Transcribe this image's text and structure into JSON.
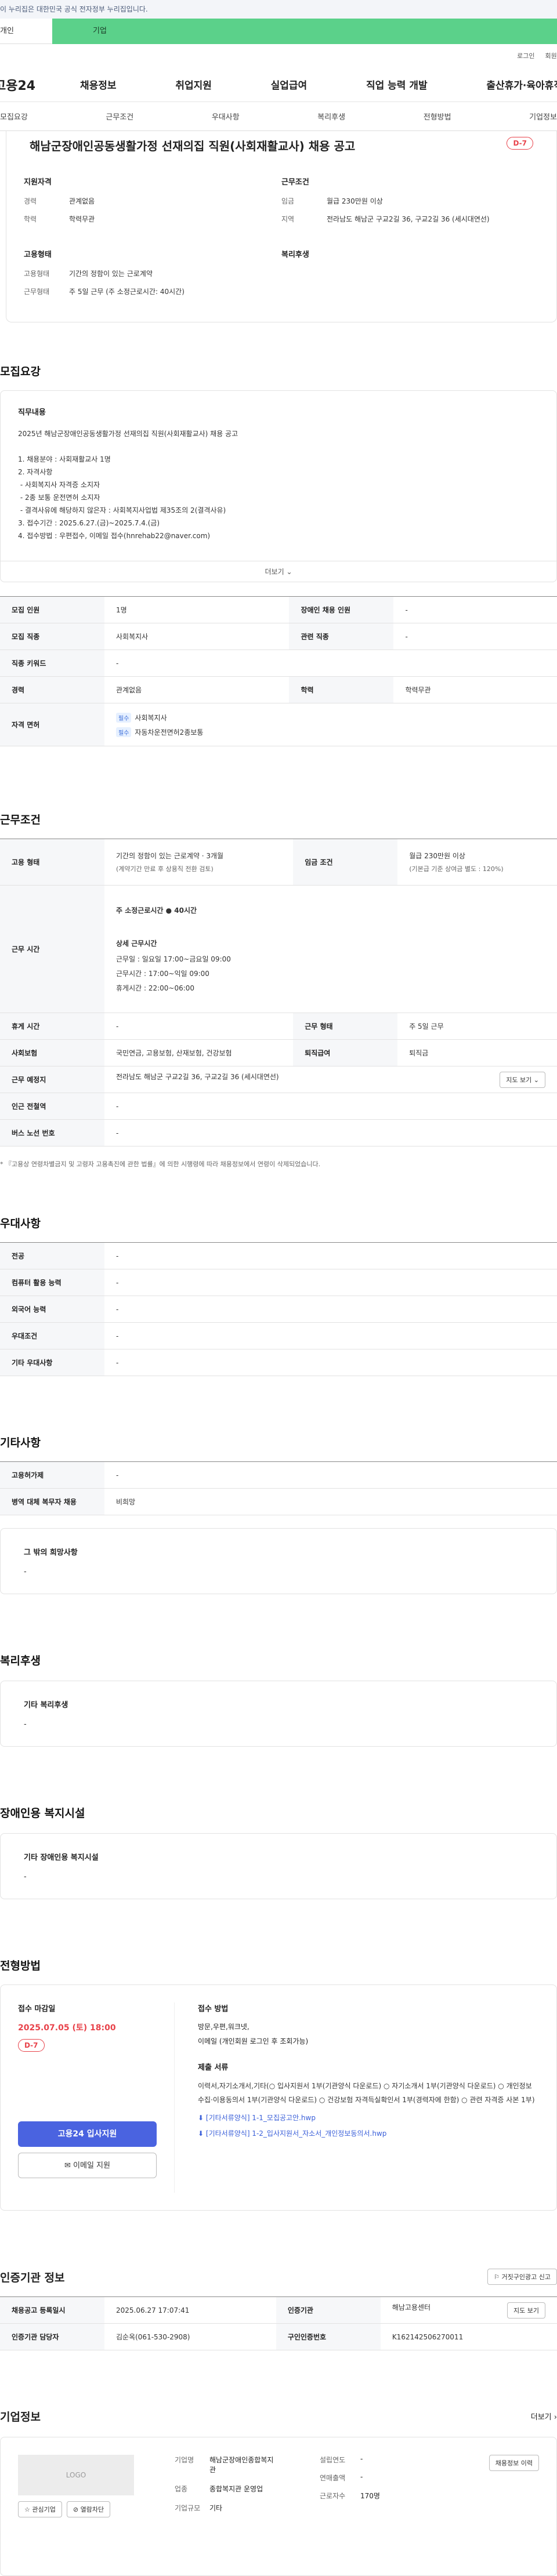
{
  "gov_notice": "이 누리집은 대한민국 공식 전자정부 누리집입니다.",
  "tabs": {
    "personal": "개인",
    "company": "기업"
  },
  "top_links": [
    "로그인",
    "회원가입"
  ],
  "logo": "고용24",
  "gnb": [
    "채용정보",
    "취업지원",
    "실업급여",
    "직업 능력 개발",
    "출산휴가·육아휴직"
  ],
  "anchors": [
    "모집요강",
    "근무조건",
    "우대사항",
    "복리후생",
    "전형방법",
    "기업정보"
  ],
  "summary": {
    "title": "해남군장애인공동생활가정 선재의집 직원(사회재활교사) 채용 공고",
    "dday": "D-7",
    "qual_head": "지원자격",
    "career_k": "경력",
    "career_v": "관계없음",
    "edu_k": "학력",
    "edu_v": "학력무관",
    "emp_head": "고용형태",
    "emp_k": "고용형태",
    "emp_v": "기간의 정함이 있는 근로계약",
    "worktype_k": "근무형태",
    "worktype_v": "주 5일 근무 (주 소정근로시간: 40시간)",
    "cond_head": "근무조건",
    "wage_k": "임금",
    "wage_v": "월급 230만원 이상",
    "area_k": "지역",
    "area_v": "전라남도 해남군 구교2길 36, 구교2길 36 (세시대연선)",
    "welfare_head": "복리후생"
  },
  "sections": {
    "recruit": "모집요강",
    "cond": "근무조건",
    "pref": "우대사항",
    "etc": "기타사항",
    "welfare": "복리후생",
    "disabled": "장애인용 복지시설",
    "process": "전형방법",
    "cert": "인증기관 정보",
    "company": "기업정보"
  },
  "job_desc": {
    "head": "직무내용",
    "text": "2025년 해남군장애인공동생활가정 선재의집 직원(사회재활교사) 채용 공고\n\n1. 채용분야 : 사회재활교사 1명\n2. 자격사항\n - 사회복지사 자격증 소지자\n - 2종 보통 운전면허 소지자\n - 결격사유에 해당하지 않은자 : 사회복지사업법 제35조의 2(결격사유)\n3. 접수기간 : 2025.6.27.(금)~2025.7.4.(금)\n4. 접수방법 : 우편접수, 이메일 접수(hnrehab22@naver.com)",
    "more": "더보기"
  },
  "recruit_table": {
    "count_k": "모집 인원",
    "count_v": "1명",
    "dis_k": "장애인 채용 인원",
    "dis_v": "-",
    "job_k": "모집 직종",
    "job_v": "사회복지사",
    "rel_k": "관련 직종",
    "rel_v": "-",
    "kw_k": "직종 키워드",
    "kw_v": "-",
    "career_k": "경력",
    "career_v": "관계없음",
    "edu_k": "학력",
    "edu_v": "학력무관",
    "lic_k": "자격 면허",
    "lic_badge": "필수",
    "lic1": "사회복지사",
    "lic2": "자동차운전면허2종보통"
  },
  "cond_table": {
    "emp_k": "고용 형태",
    "emp_v": "기간의 정함이 있는 근로계약 · 3개월",
    "emp_v2": "(계약기간 만료 후 상용직 전환 검토)",
    "wage_k": "임금 조건",
    "wage_v": "월급 230만원 이상",
    "wage_v2": "(기본급 기준 상여금 별도 : 120%)",
    "time_k": "근무 시간",
    "time_weekly": "주 소정근로시간 ● 40시간",
    "time_detail_head": "상세 근무시간",
    "time_l1": "근무일 : 일요일 17:00~금요일 09:00",
    "time_l2": "근무시간 : 17:00~익일 09:00",
    "time_l3": "휴게시간 : 22:00~06:00",
    "rest_k": "휴게 시간",
    "rest_v": "-",
    "form_k": "근무 형태",
    "form_v": "주 5일 근무",
    "ins_k": "사회보험",
    "ins_v": "국민연금, 고용보험, 산재보험, 건강보험",
    "sev_k": "퇴직급여",
    "sev_v": "퇴직금",
    "place_k": "근무 예정지",
    "place_v": "전라남도 해남군 구교2길 36, 구교2길 36 (세시대연선)",
    "map_btn": "지도 보기",
    "station_k": "인근 전철역",
    "station_v": "-",
    "bus_k": "버스 노선 번호",
    "bus_v": "-",
    "note": "* 『고용상 연령차별금지 및 고령자 고용촉진에 관한 법률』에 의한 시행령에 따라 채용정보에서 연령이 삭제되었습니다."
  },
  "pref_table": [
    {
      "k": "전공",
      "v": "-"
    },
    {
      "k": "컴퓨터 활용 능력",
      "v": "-"
    },
    {
      "k": "외국어 능력",
      "v": "-"
    },
    {
      "k": "우대조건",
      "v": "-"
    },
    {
      "k": "기타 우대사항",
      "v": "-"
    }
  ],
  "etc_table": [
    {
      "k": "고용허가제",
      "v": "-"
    },
    {
      "k": "병역 대체 복무자 채용",
      "v": "비희망"
    }
  ],
  "etc_box": {
    "head": "그 밖의 희망사항",
    "value": "-"
  },
  "welfare_box": {
    "head": "기타 복리후생",
    "value": "-"
  },
  "disabled_box": {
    "head": "기타 장애인용 복지시설",
    "value": "-"
  },
  "process": {
    "deadline_head": "접수 마감일",
    "deadline": "2025.07.05 (토) 18:00",
    "dday": "D-7",
    "apply_btn": "고용24 입사지원",
    "email_btn": "이메일 지원",
    "method_head": "접수 방법",
    "method_v1": "방문,우편,워크넷,",
    "method_v2": "이메일 (개인회원 로그인 후 조회가능)",
    "doc_head": "제출 서류",
    "doc_v": "이력서,자기소개서,기타(○ 입사지원서 1부(기관양식 다운로드) ○ 자기소개서 1부(기관양식 다운로드) ○ 개인정보 수집·이용동의서 1부(기관양식 다운로드) ○ 건강보험 자격득실확인서 1부(경력자에 한함) ○ 관련 자격증 사본 1부)",
    "file1": "[기타서류양식] 1-1_모집공고안.hwp",
    "file2": "[기타서류양식] 1-2_입사지원서_자소서_개인정보동의서.hwp"
  },
  "cert": {
    "btn": "거짓구인광고 신고",
    "reg_k": "채용공고 등록일시",
    "reg_v": "2025.06.27 17:07:41",
    "org_k": "인증기관",
    "org_v": "해남고용센터",
    "map_btn": "지도 보기",
    "mgr_k": "인증기관 담당자",
    "mgr_v": "김순옥(061-530-2908)",
    "no_k": "구인인증번호",
    "no_v": "K162142506270011"
  },
  "company": {
    "more": "더보기",
    "logo": "LOGO",
    "fav_btn": "관심기업",
    "block_btn": "열람차단",
    "info_btn": "채용정보 이력",
    "name_k": "기업명",
    "name_v": "해남군장애인종합복지관",
    "year_k": "설립연도",
    "year_v": "-",
    "sales_k": "연매출액",
    "sales_v": "-",
    "ind_k": "업종",
    "ind_v": "종합복지관 운영업",
    "emp_k": "근로자수",
    "emp_v": "170명",
    "size_k": "기업규모",
    "size_v": "기타"
  }
}
